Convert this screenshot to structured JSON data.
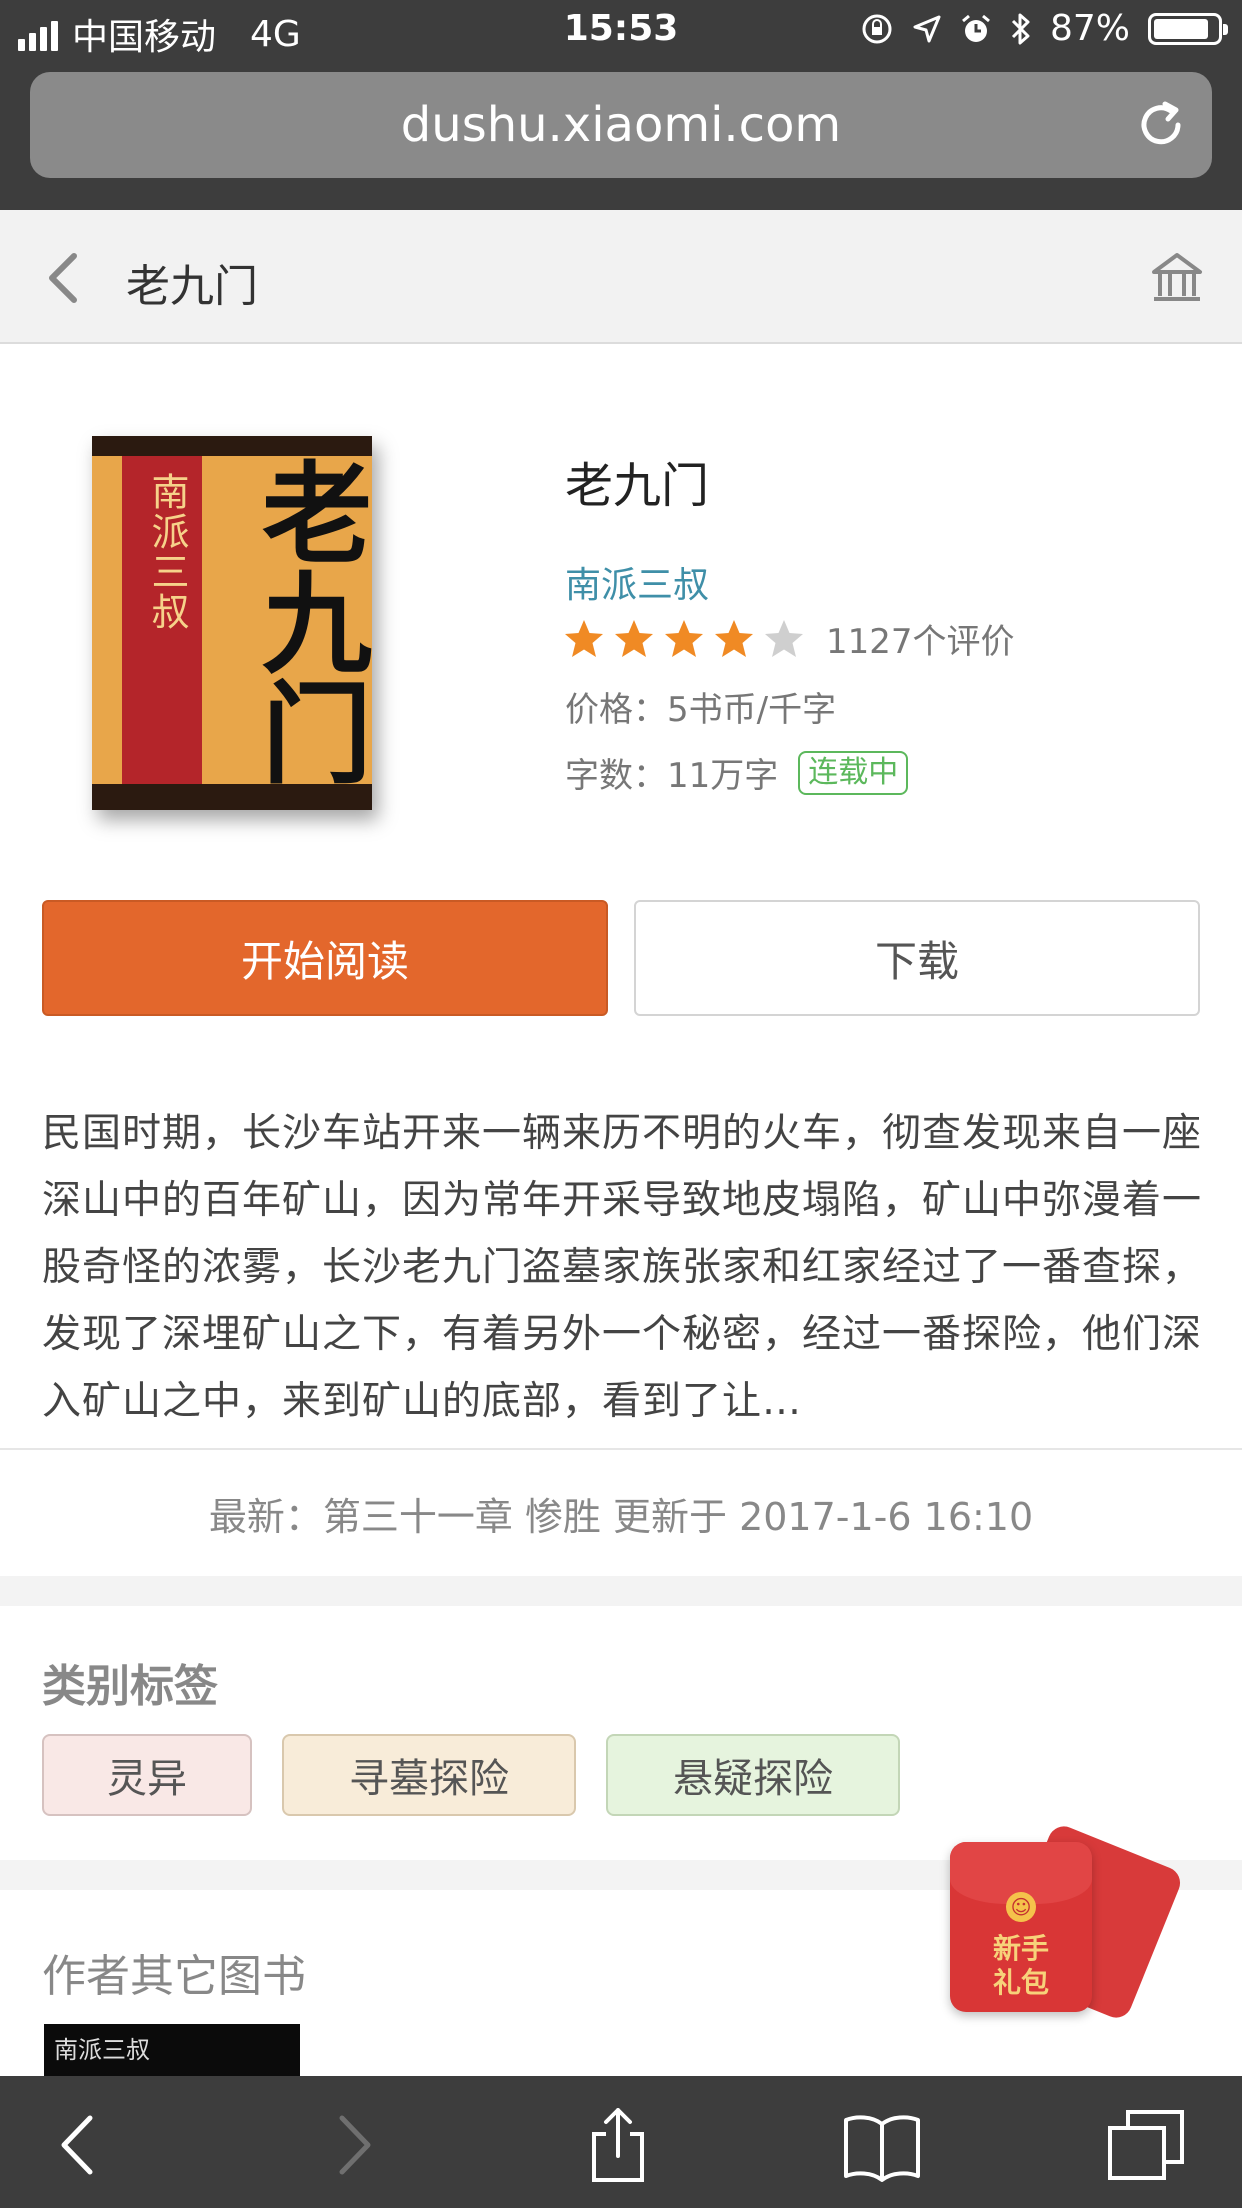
{
  "status_bar": {
    "carrier": "中国移动",
    "network": "4G",
    "time": "15:53",
    "battery": "87%",
    "battery_level": 0.87
  },
  "browser": {
    "url": "dushu.xiaomi.com"
  },
  "header": {
    "title": "老九门"
  },
  "book": {
    "cover_author": "南派三叔",
    "cover_title": "老九门",
    "title": "老九门",
    "author": "南派三叔",
    "rating_stars": 4,
    "rating_max": 5,
    "rating_count": "1127个评价",
    "price": "价格：5书币/千字",
    "words": "字数：11万字",
    "status": "连载中",
    "description": "民国时期，长沙车站开来一辆来历不明的火车，彻查发现来自一座深山中的百年矿山，因为常年开采导致地皮塌陷，矿山中弥漫着一股奇怪的浓雾，长沙老九门盗墓家族张家和红家经过了一番查探，发现了深埋矿山之下，有着另外一个秘密，经过一番探险，他们深入矿山之中，来到矿山的底部，看到了让…",
    "latest": "最新：第三十一章 惨胜 更新于 2017-1-6 16:10"
  },
  "actions": {
    "read_label": "开始阅读",
    "download_label": "下载"
  },
  "tags": {
    "title": "类别标签",
    "items": [
      "灵异",
      "寻墓探险",
      "悬疑探险"
    ]
  },
  "other_books": {
    "title": "作者其它图书",
    "thumb_text": "南派三叔"
  },
  "gift": {
    "line1": "新手",
    "line2": "礼包"
  },
  "colors": {
    "accent": "#e3672c",
    "author_link": "#3f8fa8",
    "status_green": "#5cb85c",
    "chrome": "#3d3d3d"
  }
}
